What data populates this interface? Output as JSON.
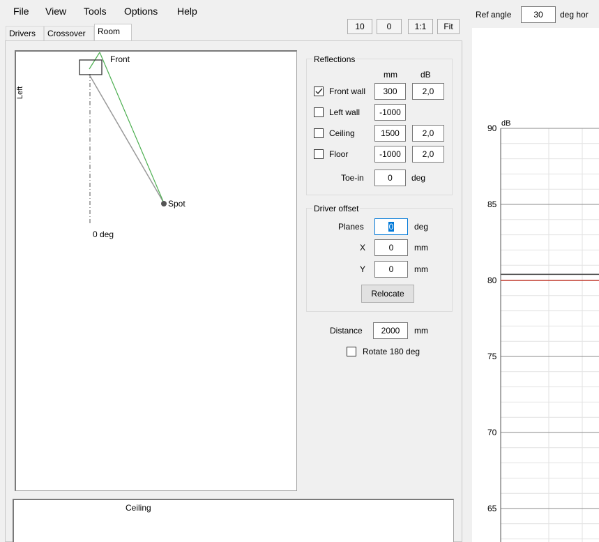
{
  "menu": {
    "items": [
      "File",
      "View",
      "Tools",
      "Options",
      "Help"
    ]
  },
  "toolbar": {
    "btn_10": "10",
    "btn_0": "0",
    "btn_1to1": "1:1",
    "btn_fit": "Fit"
  },
  "tabs": [
    {
      "label": "Drivers",
      "active": false
    },
    {
      "label": "Crossover",
      "active": false
    },
    {
      "label": "Room",
      "active": true
    }
  ],
  "room_view": {
    "front": "Front",
    "left": "Left",
    "spot": "Spot",
    "zero_deg": "0 deg",
    "ceiling": "Ceiling"
  },
  "reflections": {
    "title": "Reflections",
    "col_mm": "mm",
    "col_db": "dB",
    "rows": [
      {
        "label": "Front wall",
        "checked": true,
        "mm": "300",
        "db": "2,0"
      },
      {
        "label": "Left wall",
        "checked": false,
        "mm": "-1000",
        "db": ""
      },
      {
        "label": "Ceiling",
        "checked": false,
        "mm": "1500",
        "db": "2,0"
      },
      {
        "label": "Floor",
        "checked": false,
        "mm": "-1000",
        "db": "2,0"
      }
    ],
    "toe_in_label": "Toe-in",
    "toe_in_value": "0",
    "toe_in_unit": "deg"
  },
  "driver_offset": {
    "title": "Driver offset",
    "planes_label": "Planes",
    "planes_value": "0",
    "planes_unit": "deg",
    "x_label": "X",
    "x_value": "0",
    "x_unit": "mm",
    "y_label": "Y",
    "y_value": "0",
    "y_unit": "mm",
    "relocate": "Relocate"
  },
  "distance": {
    "label": "Distance",
    "value": "2000",
    "unit": "mm"
  },
  "rotate": {
    "label": "Rotate 180 deg",
    "checked": false
  },
  "ref_angle": {
    "label": "Ref angle",
    "value": "30",
    "unit": "deg hor"
  },
  "chart_data": {
    "type": "line",
    "ylabel": "dB",
    "y_ticks": [
      90,
      85,
      80,
      75,
      70,
      65
    ],
    "series": [
      {
        "values": [
          80.4
        ],
        "color": "#555555"
      },
      {
        "values": [
          80.0
        ],
        "color": "#c0392b"
      }
    ]
  },
  "colors": {
    "direct_path": "#999999",
    "reflection_path": "#4caf50",
    "selection": "#0078d7"
  }
}
